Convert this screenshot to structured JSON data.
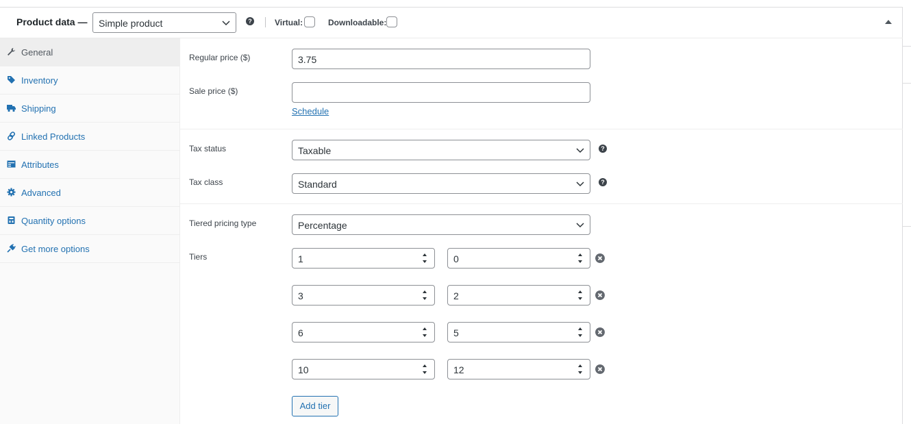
{
  "header": {
    "title": "Product data —",
    "product_type": "Simple product",
    "virtual_label": "Virtual:",
    "virtual_checked": false,
    "downloadable_label": "Downloadable:",
    "downloadable_checked": false
  },
  "sidebar": {
    "items": [
      {
        "label": "General",
        "icon": "wrench-icon",
        "active": true
      },
      {
        "label": "Inventory",
        "icon": "tag-icon",
        "active": false
      },
      {
        "label": "Shipping",
        "icon": "truck-icon",
        "active": false
      },
      {
        "label": "Linked Products",
        "icon": "link-icon",
        "active": false
      },
      {
        "label": "Attributes",
        "icon": "table-icon",
        "active": false
      },
      {
        "label": "Advanced",
        "icon": "gear-icon",
        "active": false
      },
      {
        "label": "Quantity options",
        "icon": "box-icon",
        "active": false
      },
      {
        "label": "Get more options",
        "icon": "plugin-icon",
        "active": false
      }
    ]
  },
  "pricing": {
    "regular_price_label": "Regular price ($)",
    "regular_price_value": "3.75",
    "sale_price_label": "Sale price ($)",
    "sale_price_value": "",
    "schedule_link": "Schedule"
  },
  "tax": {
    "status_label": "Tax status",
    "status_value": "Taxable",
    "class_label": "Tax class",
    "class_value": "Standard"
  },
  "tiered": {
    "type_label": "Tiered pricing type",
    "type_value": "Percentage",
    "tiers_label": "Tiers",
    "tiers": [
      {
        "quantity": "1",
        "discount": "0"
      },
      {
        "quantity": "3",
        "discount": "2"
      },
      {
        "quantity": "6",
        "discount": "5"
      },
      {
        "quantity": "10",
        "discount": "12"
      }
    ],
    "add_tier_label": "Add tier"
  },
  "colors": {
    "link": "#2271b1",
    "text": "#1d2327",
    "border": "#8c8f94",
    "sidebar_bg": "#fafafa",
    "active_tab_bg": "#eeeeee"
  }
}
